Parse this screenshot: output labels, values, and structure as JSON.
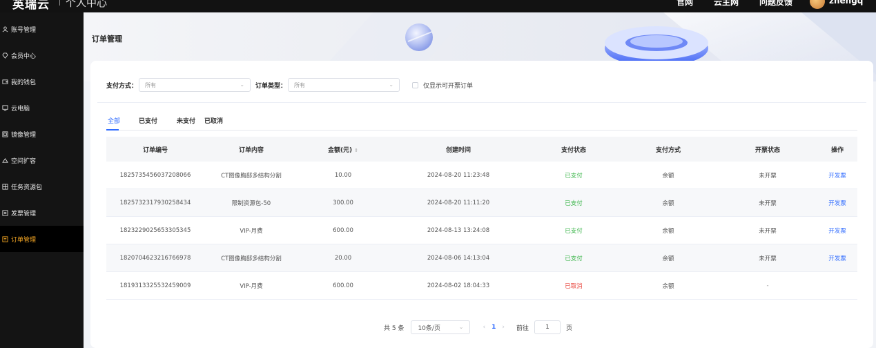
{
  "topbar": {
    "brand": "英瑞云",
    "subtitle": "个人中心",
    "nav": [
      "官网",
      "云主网",
      "问题反馈"
    ],
    "user": "zhengq"
  },
  "sidebar": {
    "items": [
      {
        "label": "账号管理",
        "icon": "user-icon"
      },
      {
        "label": "会员中心",
        "icon": "diamond-icon"
      },
      {
        "label": "我的钱包",
        "icon": "wallet-icon"
      },
      {
        "label": "云电脑",
        "icon": "monitor-icon"
      },
      {
        "label": "镜像管理",
        "icon": "image-icon"
      },
      {
        "label": "空间扩容",
        "icon": "cloud-icon"
      },
      {
        "label": "任务资源包",
        "icon": "package-icon"
      },
      {
        "label": "发票管理",
        "icon": "invoice-icon"
      },
      {
        "label": "订单管理",
        "icon": "order-icon",
        "active": true
      }
    ]
  },
  "page": {
    "title": "订单管理"
  },
  "filters": {
    "pay_method_label": "支付方式：",
    "pay_method_value": "所有",
    "order_type_label": "订单类型：",
    "order_type_value": "所有",
    "invoiceable_only": "仅显示可开票订单"
  },
  "tabs": [
    "全部",
    "已支付",
    "未支付",
    "已取消"
  ],
  "table": {
    "headers": [
      "订单编号",
      "订单内容",
      "金额(元)",
      "创建时间",
      "支付状态",
      "支付方式",
      "开票状态",
      "操作"
    ],
    "rows": [
      {
        "id": "1825735456037208066",
        "content": "CT图像胸部多结构分割",
        "amount": "10.00",
        "time": "2024-08-20 11:23:48",
        "status": "已支付",
        "method": "余额",
        "invoice": "未开票",
        "action": "开发票"
      },
      {
        "id": "1825732317930258434",
        "content": "限制资源包-50",
        "amount": "300.00",
        "time": "2024-08-20 11:11:20",
        "status": "已支付",
        "method": "余额",
        "invoice": "未开票",
        "action": "开发票"
      },
      {
        "id": "1823229025653305345",
        "content": "VIP-月费",
        "amount": "600.00",
        "time": "2024-08-13 13:24:08",
        "status": "已支付",
        "method": "余额",
        "invoice": "未开票",
        "action": "开发票"
      },
      {
        "id": "1820704623216766978",
        "content": "CT图像胸部多结构分割",
        "amount": "20.00",
        "time": "2024-08-06 14:13:04",
        "status": "已支付",
        "method": "余额",
        "invoice": "未开票",
        "action": "开发票"
      },
      {
        "id": "1819313325532459009",
        "content": "VIP-月费",
        "amount": "600.00",
        "time": "2024-08-02 18:04:33",
        "status": "已取消",
        "method": "余额",
        "invoice": "-",
        "action": ""
      }
    ]
  },
  "pagination": {
    "total": "共 5 条",
    "page_size": "10条/页",
    "current": "1",
    "goto_label": "前往",
    "goto_value": "1",
    "page_unit": "页"
  },
  "colors": {
    "accent": "#2f6bff",
    "paid": "#3bb54a",
    "cancelled": "#e8453c",
    "sidebar_active": "#f5a623"
  }
}
